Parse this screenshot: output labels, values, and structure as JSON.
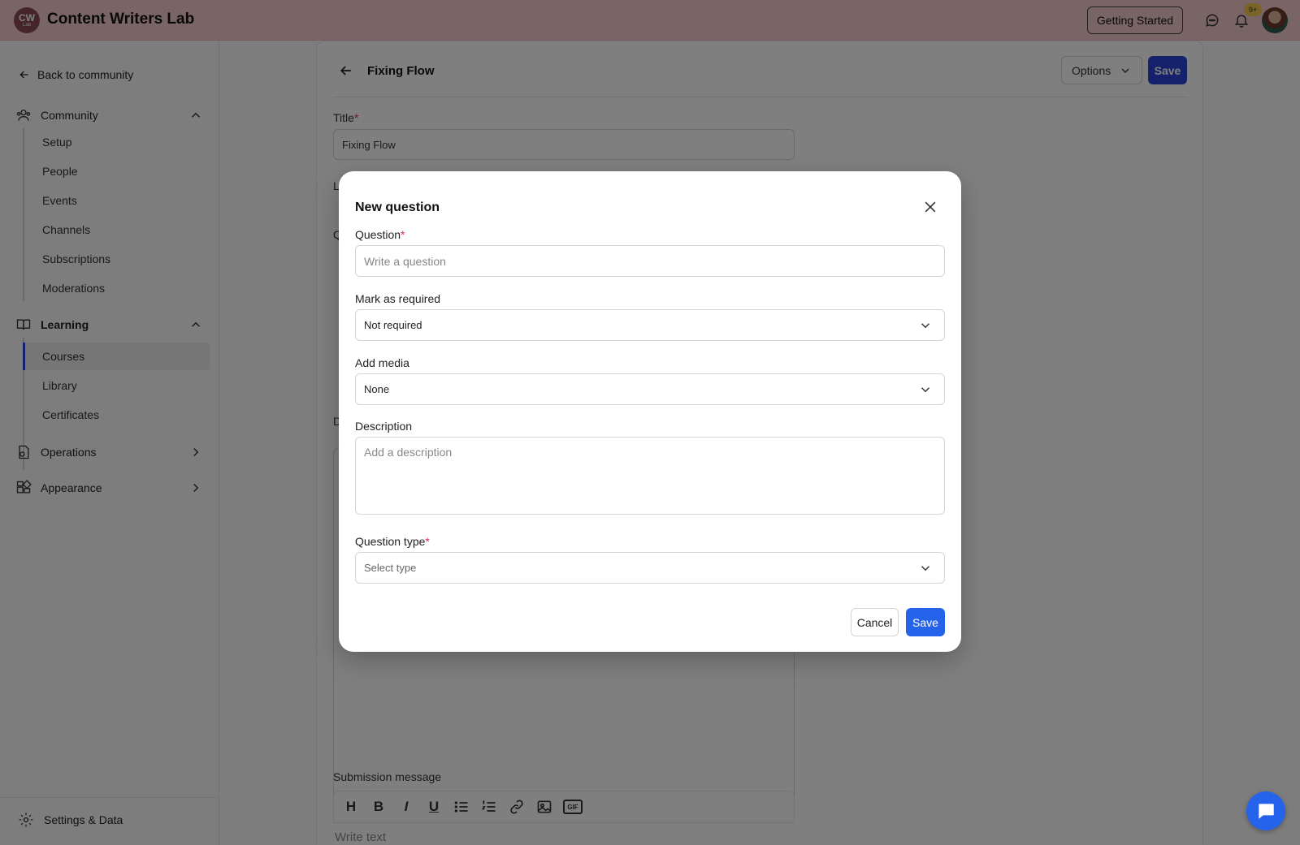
{
  "header": {
    "logo_text": "CW",
    "logo_sub": "Lab",
    "brand": "Content Writers Lab",
    "getting_started": "Getting Started",
    "notification_badge": "9+"
  },
  "sidebar": {
    "back_link": "Back to community",
    "community": {
      "label": "Community",
      "items": [
        "Setup",
        "People",
        "Events",
        "Channels",
        "Subscriptions",
        "Moderations"
      ]
    },
    "learning": {
      "label": "Learning",
      "items": [
        "Courses",
        "Library",
        "Certificates"
      ],
      "active": "Courses"
    },
    "operations": "Operations",
    "appearance": "Appearance",
    "settings": "Settings & Data"
  },
  "card": {
    "title": "Fixing Flow",
    "options_label": "Options",
    "save_label": "Save",
    "title_label": "Title",
    "title_value": "Fixing Flow",
    "stub_l": "L",
    "stub_q": "Q",
    "stub_d": "D",
    "submission_label": "Submission message",
    "toolbar": {
      "heading": "H",
      "bold": "B",
      "italic": "I",
      "underline": "U",
      "gif": "GIF"
    },
    "write_placeholder": "Write text"
  },
  "modal": {
    "title": "New question",
    "question_label": "Question",
    "question_placeholder": "Write a question",
    "required_label": "Mark as required",
    "required_value": "Not required",
    "media_label": "Add media",
    "media_value": "None",
    "description_label": "Description",
    "description_placeholder": "Add a description",
    "type_label": "Question type",
    "type_placeholder": "Select type",
    "cancel": "Cancel",
    "save": "Save",
    "required_mark": "*"
  },
  "colors": {
    "header_bg": "#f3c9cd",
    "primary": "#2b44d6",
    "modal_save": "#2563eb",
    "required": "#e0245e"
  }
}
